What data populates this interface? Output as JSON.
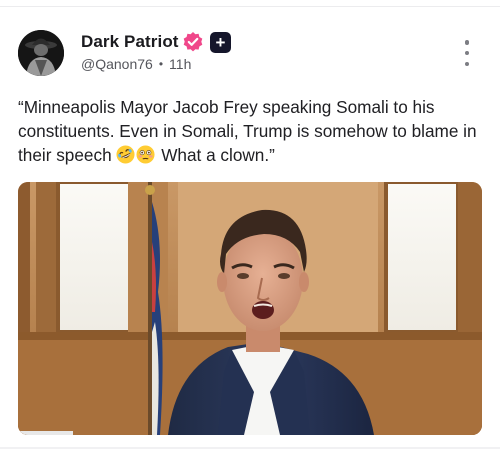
{
  "post": {
    "author_name": "Dark Patriot",
    "handle": "@Qanon76",
    "separator": "•",
    "time_ago": "11h",
    "plus_badge": "+",
    "text": "“Minneapolis Mayor Jacob Frey speaking Somali to his constituents. Even in Somali, Trump is somehow to blame in their speech",
    "text_tail": " What a clown.”",
    "emojis": [
      "rolling-on-floor-laughing-emoji",
      "flushed-face-emoji"
    ],
    "icons": {
      "verified": "verified-badge-icon",
      "more": "more-vertical-icon",
      "plus": "plus-badge-icon"
    },
    "colors": {
      "verified_badge": "#f0478a",
      "plus_badge": "#15162b"
    }
  }
}
